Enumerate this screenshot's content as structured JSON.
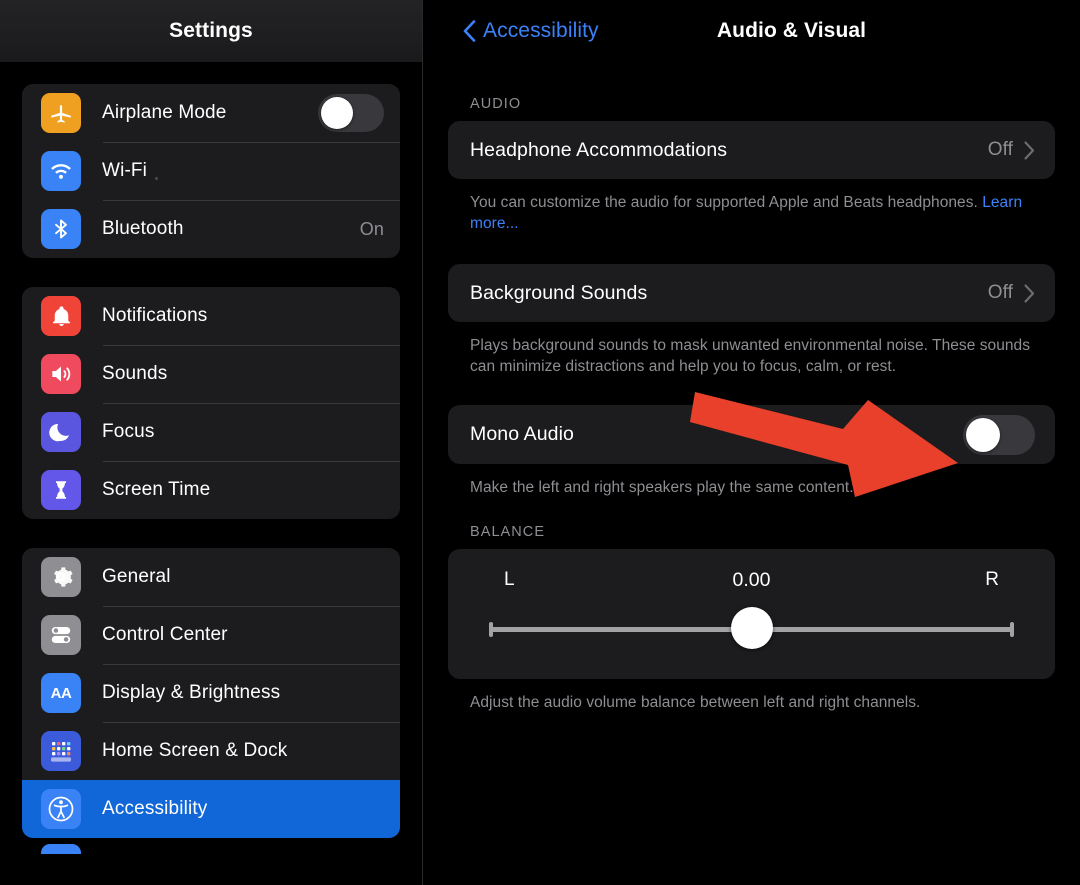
{
  "sidebar": {
    "header_title": "Settings",
    "groups": [
      {
        "items": [
          {
            "label": "Airplane Mode",
            "icon": "airplane-icon",
            "icon_color": "#f0a020",
            "control": "toggle",
            "toggle_on": false
          },
          {
            "label": "Wi-Fi",
            "icon": "wifi-icon",
            "icon_color": "#3a83f6",
            "control": "dot",
            "value": ""
          },
          {
            "label": "Bluetooth",
            "icon": "bluetooth-icon",
            "icon_color": "#3a83f6",
            "control": "value",
            "value": "On"
          }
        ]
      },
      {
        "items": [
          {
            "label": "Notifications",
            "icon": "bell-icon",
            "icon_color": "#f04438",
            "control": "none",
            "value": ""
          },
          {
            "label": "Sounds",
            "icon": "speaker-icon",
            "icon_color": "#f04a5e",
            "control": "none",
            "value": ""
          },
          {
            "label": "Focus",
            "icon": "moon-icon",
            "icon_color": "#5b56e0",
            "control": "none",
            "value": ""
          },
          {
            "label": "Screen Time",
            "icon": "hourglass-icon",
            "icon_color": "#6257e8",
            "control": "none",
            "value": ""
          }
        ]
      },
      {
        "items": [
          {
            "label": "General",
            "icon": "gear-icon",
            "icon_color": "#8e8e93",
            "control": "none",
            "value": ""
          },
          {
            "label": "Control Center",
            "icon": "control-center-icon",
            "icon_color": "#8e8e93",
            "control": "none",
            "value": ""
          },
          {
            "label": "Display & Brightness",
            "icon": "display-brightness-icon",
            "icon_color": "#3a83f6",
            "control": "none",
            "value": ""
          },
          {
            "label": "Home Screen & Dock",
            "icon": "home-screen-dock-icon",
            "icon_color": "#3b5bdb",
            "control": "none",
            "value": ""
          },
          {
            "label": "Accessibility",
            "icon": "accessibility-icon",
            "icon_color": "#3a83f6",
            "control": "none",
            "value": "",
            "selected": true
          }
        ]
      }
    ],
    "selected_highlight_color": "#1167d8"
  },
  "detail": {
    "back_label": "Accessibility",
    "title": "Audio & Visual",
    "accent_color": "#3b82f9",
    "sections": [
      {
        "header": "AUDIO",
        "rows": [
          {
            "label": "Headphone Accommodations",
            "value": "Off",
            "type": "disclosure"
          }
        ],
        "footer": "You can customize the audio for supported Apple and Beats headphones. ",
        "footer_link": "Learn more..."
      },
      {
        "header": "",
        "rows": [
          {
            "label": "Background Sounds",
            "value": "Off",
            "type": "disclosure"
          }
        ],
        "footer": "Plays background sounds to mask unwanted environmental noise. These sounds can minimize distractions and help you to focus, calm, or rest.",
        "footer_link": ""
      },
      {
        "header": "",
        "rows": [
          {
            "label": "Mono Audio",
            "value": "",
            "type": "toggle",
            "toggle_on": false
          }
        ],
        "footer": "Make the left and right speakers play the same content.",
        "footer_link": ""
      }
    ],
    "balance": {
      "header": "BALANCE",
      "left_label": "L",
      "right_label": "R",
      "value": "0.00",
      "slider_position_percent": 50,
      "footer": "Adjust the audio volume balance between left and right channels."
    }
  },
  "annotation": {
    "arrow_color": "#e8402a",
    "arrow_name": "red-pointer-arrow",
    "points_to": "Mono Audio toggle"
  }
}
